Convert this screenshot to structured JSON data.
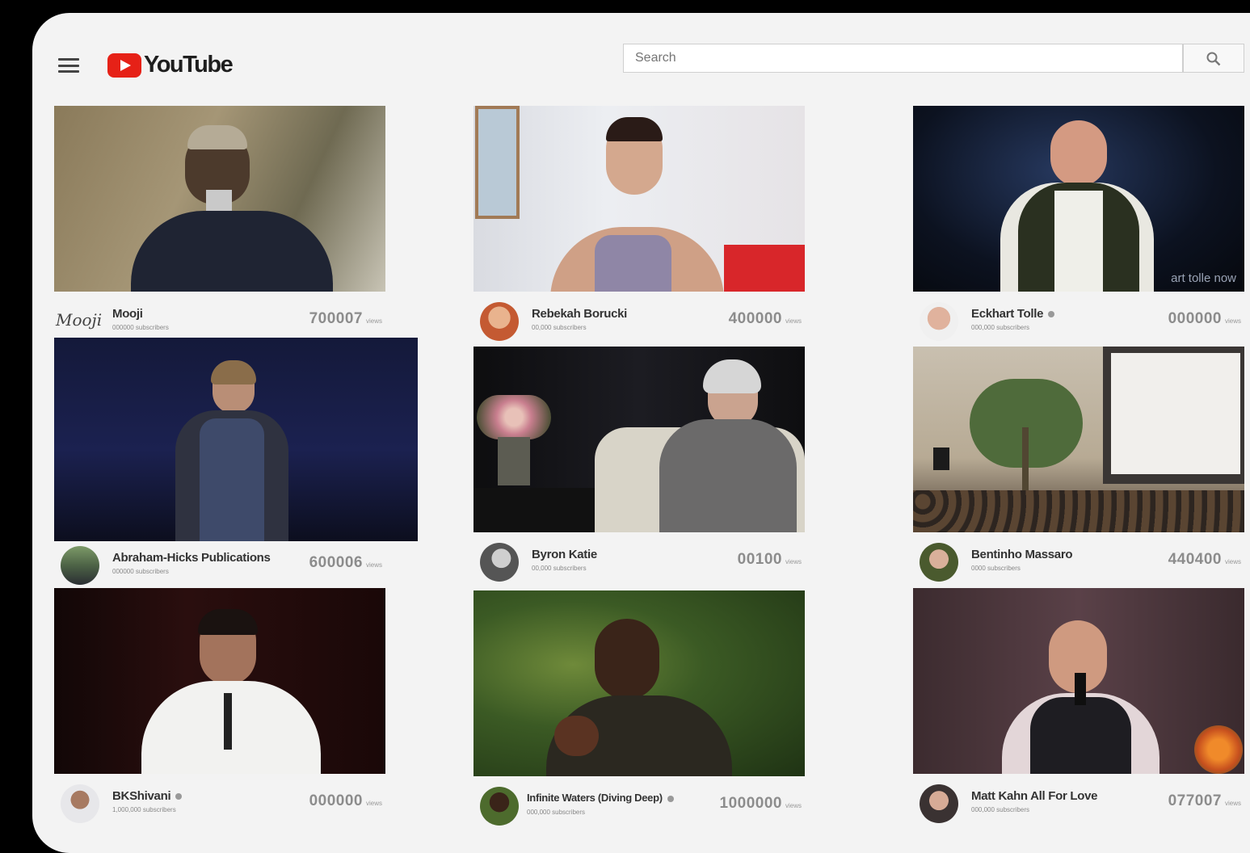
{
  "header": {
    "logo_text": "YouTube",
    "search_placeholder": "Search",
    "icons": {
      "menu": "hamburger-menu-icon",
      "search": "magnifier-search-icon",
      "logo": "youtube-play-icon"
    }
  },
  "colors": {
    "brand_red": "#e62117",
    "page_bg": "#f3f3f3",
    "frame": "#000000"
  },
  "cards": [
    {
      "channel": "Mooji",
      "subscribers": "000000 subscribers",
      "views": "700007",
      "views_unit": "views",
      "verified": false
    },
    {
      "channel": "Rebekah Borucki",
      "subscribers": "00,000 subscribers",
      "views": "400000",
      "views_unit": "views",
      "verified": false
    },
    {
      "channel": "Eckhart Tolle",
      "subscribers": "000,000 subscribers",
      "views": "000000",
      "views_unit": "views",
      "verified": true,
      "thumb_text": "art tolle now"
    },
    {
      "channel": "Abraham-Hicks Publications",
      "subscribers": "000000 subscribers",
      "views": "600006",
      "views_unit": "views",
      "verified": false
    },
    {
      "channel": "Byron Katie",
      "subscribers": "00,000 subscribers",
      "views": "00100",
      "views_unit": "views",
      "verified": false
    },
    {
      "channel": "Bentinho Massaro",
      "subscribers": "0000 subscribers",
      "views": "440400",
      "views_unit": "views",
      "verified": false
    },
    {
      "channel": "BKShivani",
      "subscribers": "1,000,000 subscribers",
      "views": "000000",
      "views_unit": "views",
      "verified": true
    },
    {
      "channel": "Infinite Waters (Diving Deep)",
      "subscribers": "000,000 subscribers",
      "views": "1000000",
      "views_unit": "views",
      "verified": true
    },
    {
      "channel": "Matt Kahn All For Love",
      "subscribers": "000,000 subscribers",
      "views": "077007",
      "views_unit": "views",
      "verified": false
    }
  ]
}
